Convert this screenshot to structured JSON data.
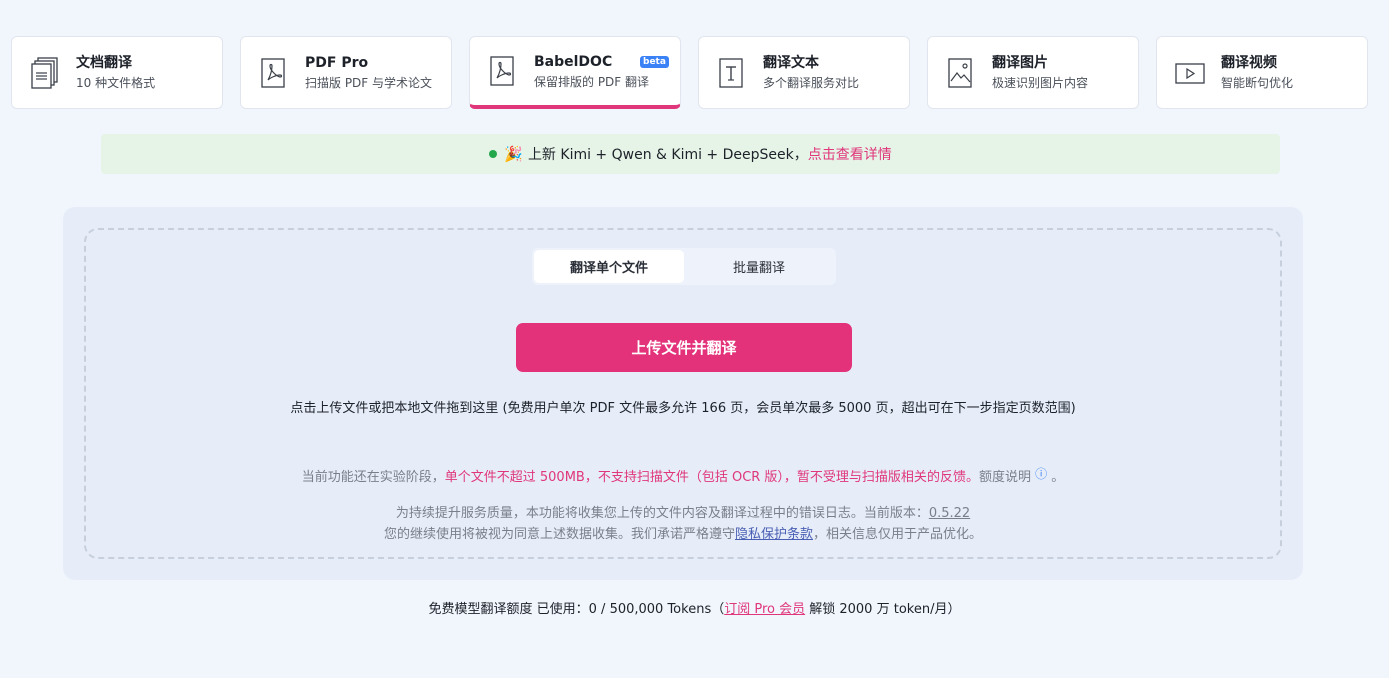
{
  "cards": [
    {
      "title": "文档翻译",
      "sub": "10 种文件格式",
      "icon": "documents-icon"
    },
    {
      "title": "PDF Pro",
      "sub": "扫描版 PDF 与学术论文",
      "icon": "pdf-icon"
    },
    {
      "title": "BabelDOC",
      "sub": "保留排版的 PDF 翻译",
      "icon": "pdf-icon",
      "badge": "beta"
    },
    {
      "title": "翻译文本",
      "sub": "多个翻译服务对比",
      "icon": "text-icon"
    },
    {
      "title": "翻译图片",
      "sub": "极速识别图片内容",
      "icon": "image-icon"
    },
    {
      "title": "翻译视频",
      "sub": "智能断句优化",
      "icon": "video-icon"
    }
  ],
  "notice": {
    "emoji": "🎉",
    "text": " 上新 Kimi + Qwen & Kimi + DeepSeek，",
    "link": "点击查看详情"
  },
  "tabs": {
    "single": "翻译单个文件",
    "batch": "批量翻译"
  },
  "upload_button": "上传文件并翻译",
  "hint": "点击上传文件或把本地文件拖到这里 (免费用户单次 PDF 文件最多允许 166 页，会员单次最多 5000 页，超出可在下一步指定页数范围)",
  "warning": {
    "prefix": "当前功能还在实验阶段，",
    "red": "单个文件不超过 500MB，不支持扫描文件（包括 OCR 版），暂不受理与扫描版相关的反馈。",
    "suffix": "额度说明",
    "info": "ⓘ",
    "end": " 。"
  },
  "legal": {
    "line1_prefix": "为持续提升服务质量，本功能将收集您上传的文件内容及翻译过程中的错误日志。当前版本：",
    "version": "0.5.22",
    "line2_prefix": "您的继续使用将被视为同意上述数据收集。我们承诺严格遵守",
    "privacy": "隐私保护条款",
    "line2_suffix": "，相关信息仅用于产品优化。"
  },
  "quota": {
    "prefix": "免费模型翻译额度 已使用：0 / 500,000 Tokens（",
    "link": "订阅 Pro 会员",
    "suffix": " 解锁 2000 万 token/月）"
  },
  "colors": {
    "accent": "#e3327a",
    "notice_bg": "#e6f4e8",
    "dot": "#22a74b",
    "beta_bg": "#3b82f6"
  }
}
